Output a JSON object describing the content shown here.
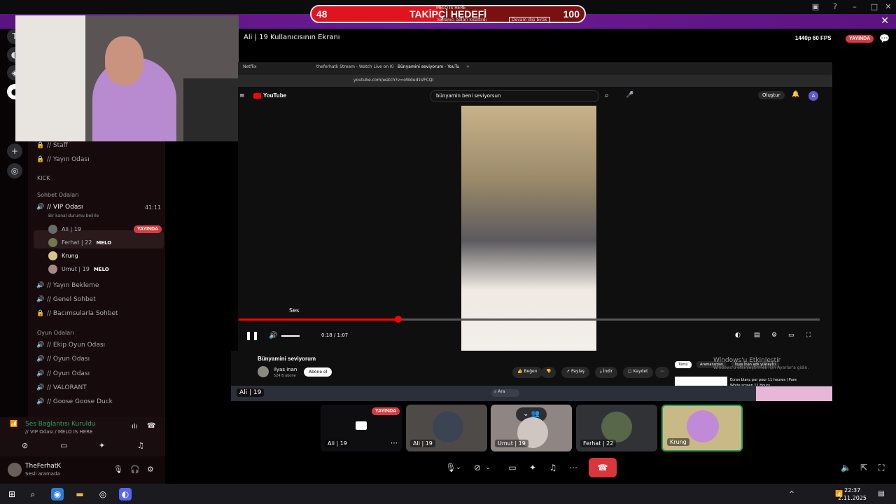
{
  "follower_goal": {
    "current": "48",
    "title": "TAKİPÇİ HEDEFİ",
    "target": "100",
    "progress": 0.48,
    "banner_top": "MELO IS HERE",
    "banner_sub": "kullanıcı adları kısaltıldı",
    "banner_link": "Devam dışı bırak"
  },
  "stream": {
    "title": "Ali | 19 Kullanıcısının Ekranı",
    "quality": "1440p 60 FPS",
    "live_badge": "YAYINDA"
  },
  "channels": {
    "staff": "// Staff",
    "yayin_odasi": "// Yayın Odası",
    "kick": "KICK",
    "sohbet_cat": "Sohbet Odaları",
    "vip": "// VIP Odası",
    "vip_time": "41:11",
    "vip_status": "Bir kanal durumu belirle",
    "users": [
      {
        "name": "Ali | 19",
        "tag": "",
        "live": "YAYINDA"
      },
      {
        "name": "Ferhat | 22",
        "tag": "MELO",
        "live": ""
      },
      {
        "name": "Krung",
        "tag": "",
        "live": ""
      },
      {
        "name": "Umut | 19",
        "tag": "MELO",
        "live": ""
      }
    ],
    "yayin_bekleme": "// Yayın Bekleme",
    "genel_sohbet": "// Genel Sohbet",
    "bacimsularla": "// Bacımsularla Sohbet",
    "oyun_cat": "Oyun Odaları",
    "ekip_oyun": "// Ekip Oyun Odası",
    "oyun1": "// Oyun Odası",
    "oyun2": "// Oyun Odası",
    "valorant": "// VALORANT",
    "goose": "// Goose Goose Duck"
  },
  "voice": {
    "status": "Ses Bağlantısı Kuruldu",
    "sub": "// VIP Odası / MELO IS HERE"
  },
  "user_panel": {
    "name": "TheFerhatK",
    "status": "Sesli aramada"
  },
  "browser": {
    "tabs": [
      "Netflix",
      "theferhatk Stream - Watch Live on Ki",
      "Bünyamini seviyorum - YouTu"
    ],
    "url": "youtube.com/watch?v=oWdud1VFCQI",
    "yt_logo": "YouTube",
    "search_value": "bünyamin beni seviyorsun",
    "create_label": "Oluştur",
    "volume_label": "Ses",
    "time": "0:18 / 1:07",
    "progress": 0.275,
    "video_title": "Bünyamini seviyorum",
    "channel": "ilyas inan",
    "subs": "524 B abone",
    "subscribe": "Abone ol",
    "like": "Beğen",
    "share": "Paylaş",
    "download": "İndir",
    "save": "Kaydet",
    "chips": [
      "Tümü",
      "Aramanızdan",
      "İlyas İnan adlı yükleyici"
    ],
    "rec_title": "Ecran blanc pur pour 11 heures | Pure White screen 11 Hours"
  },
  "windows_watermark": {
    "line1": "Windows'u Etkinleştir",
    "line2": "Windows'u etkinleştirmek için Ayarlar'a gidin."
  },
  "tiles": {
    "ali_self": "Ali | 19",
    "ali_live": "YAYINDA",
    "ali": "Ali | 19",
    "umut": "Umut | 19",
    "ferhat": "Ferhat | 22",
    "krung": "Krung"
  },
  "clock": {
    "time": "22:37",
    "date": "2.11.2025"
  },
  "colors": {
    "accent_red": "#e0141e",
    "live_red": "#d83a42",
    "purple": "#6b1a94",
    "green_ring": "#23a55a"
  }
}
